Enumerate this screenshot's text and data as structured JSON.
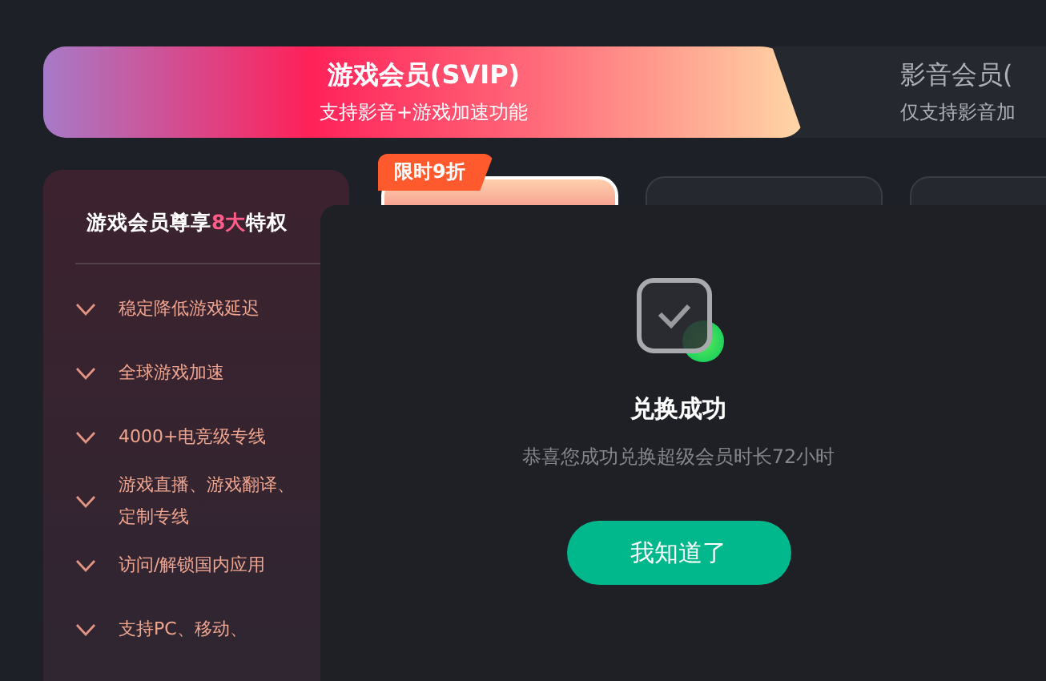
{
  "tabs": [
    {
      "title": "游戏会员(SVIP)",
      "subtitle": "支持影音+游戏加速功能",
      "selected": true
    },
    {
      "title": "影音会员(",
      "subtitle": "仅支持影音加",
      "selected": false
    }
  ],
  "privileges": {
    "title": "游戏会员尊享**8大**特权",
    "items": [
      "稳定降低游戏延迟",
      "全球游戏加速",
      "4000+电竞级专线",
      "游戏直播、游戏翻译、定制专线",
      "访问/解锁国内应用",
      "支持PC、移动、"
    ]
  },
  "plans": [
    {
      "badge": "限时9折",
      "selected": true
    },
    {
      "selected": false
    },
    {
      "selected": false
    }
  ],
  "dialog": {
    "title": "兑换成功",
    "message": "恭喜您成功兑换超级会员时长72小时",
    "button": "我知道了"
  }
}
